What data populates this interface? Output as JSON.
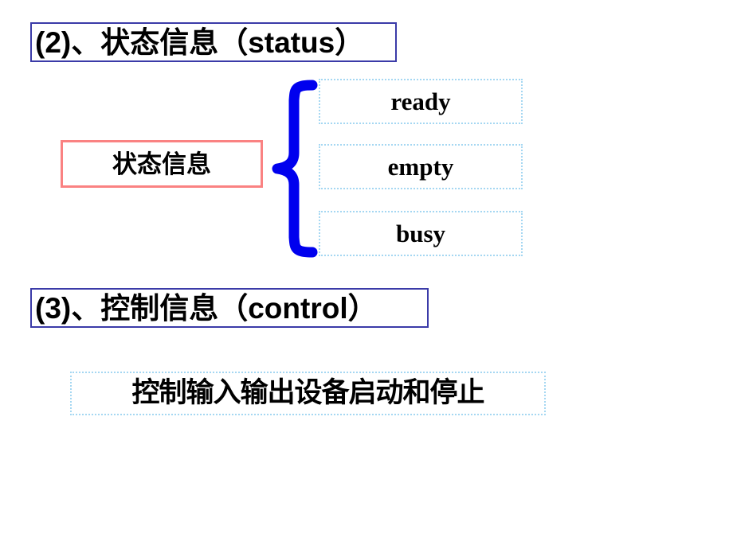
{
  "slide": {
    "background_color": "#ffffff",
    "sections": [
      {
        "id": "status",
        "heading": "(2)、状态信息（status）",
        "heading_border_color": "#3b3ba8",
        "source_label": "状态信息",
        "source_border_color": "#fa8282",
        "brace_color": "#0000ee",
        "value_border_color": "#a5d7f2",
        "values": [
          {
            "label": "ready"
          },
          {
            "label": "empty"
          },
          {
            "label": "busy"
          }
        ]
      },
      {
        "id": "control",
        "heading": "(3)、控制信息（control）",
        "heading_border_color": "#3b3ba8",
        "description": "控制输入输出设备启动和停止",
        "description_border_color": "#a5d7f2"
      }
    ]
  }
}
